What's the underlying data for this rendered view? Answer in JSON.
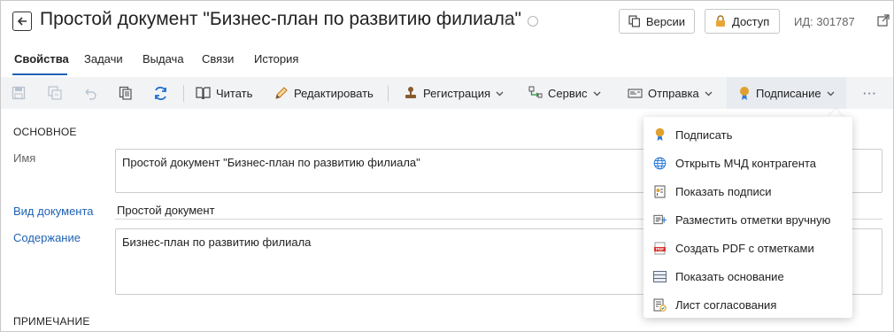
{
  "header": {
    "title": "Простой документ \"Бизнес-план по развитию филиала\"",
    "versions_label": "Версии",
    "access_label": "Доступ",
    "id_text": "ИД: 301787"
  },
  "tabs": [
    {
      "label": "Свойства",
      "active": true
    },
    {
      "label": "Задачи",
      "active": false
    },
    {
      "label": "Выдача",
      "active": false
    },
    {
      "label": "Связи",
      "active": false
    },
    {
      "label": "История",
      "active": false
    }
  ],
  "toolbar": {
    "read_label": "Читать",
    "edit_label": "Редактировать",
    "registration_label": "Регистрация",
    "service_label": "Сервис",
    "send_label": "Отправка",
    "signing_label": "Подписание",
    "more_label": "···"
  },
  "form": {
    "section_main": "ОСНОВНОЕ",
    "name_label": "Имя",
    "name_value": "Простой документ \"Бизнес-план по развитию филиала\"",
    "doc_type_label": "Вид документа",
    "doc_type_value": "Простой документ",
    "content_label": "Содержание",
    "content_value": "Бизнес-план по развитию филиала",
    "section_note": "ПРИМЕЧАНИЕ"
  },
  "signing_menu": {
    "items": [
      {
        "label": "Подписать",
        "icon": "medal-icon"
      },
      {
        "label": "Открыть МЧД контрагента",
        "icon": "globe-icon"
      },
      {
        "label": "Показать подписи",
        "icon": "signature-certificate-icon"
      },
      {
        "label": "Разместить отметки вручную",
        "icon": "place-marks-icon"
      },
      {
        "label": "Создать PDF с отметками",
        "icon": "pdf-icon"
      },
      {
        "label": "Показать основание",
        "icon": "document-lines-icon"
      },
      {
        "label": "Лист согласования",
        "icon": "approval-sheet-icon"
      }
    ]
  },
  "colors": {
    "accent": "#1f62b3",
    "toolbar_bg": "#f2f3f5",
    "medal": "#e0a030",
    "refresh": "#1f6fd0"
  }
}
